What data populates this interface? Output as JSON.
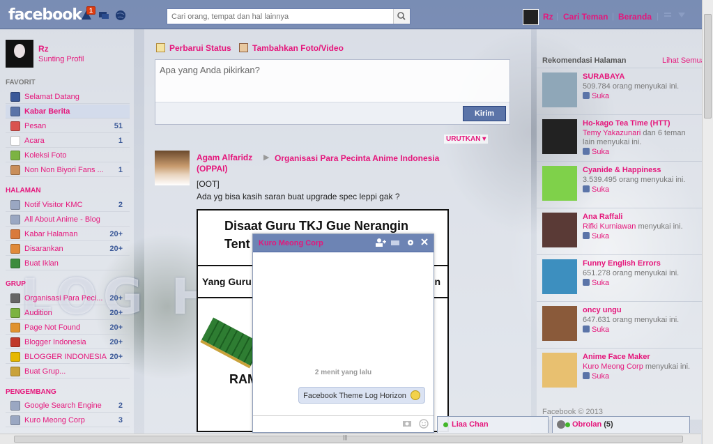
{
  "app": {
    "logo": "facebook",
    "notification_count": "1"
  },
  "search": {
    "placeholder": "Cari orang, tempat dan hal lainnya"
  },
  "topnav": {
    "user": "Rz",
    "find_friends": "Cari Teman",
    "home": "Beranda",
    "sep": "|"
  },
  "profile": {
    "name": "Rz",
    "edit": "Sunting Profil"
  },
  "sidebar": {
    "favorites_head": "FAVORIT",
    "favorites": [
      {
        "label": "Selamat Datang",
        "count": "",
        "color": "#3b5998"
      },
      {
        "label": "Kabar Berita",
        "count": "",
        "color": "#5b74a8"
      },
      {
        "label": "Pesan",
        "count": "51",
        "color": "#d9534f"
      },
      {
        "label": "Acara",
        "count": "1",
        "color": "#ffffff"
      },
      {
        "label": "Koleksi Foto",
        "count": "",
        "color": "#7cb342"
      },
      {
        "label": "Non Non Biyori Fans ...",
        "count": "1",
        "color": "#c98e5a"
      }
    ],
    "pages_head": "HALAMAN",
    "pages": [
      {
        "label": "Notif Visitor KMC",
        "count": "2",
        "color": "#9aa7c2"
      },
      {
        "label": "All About Anime - Blog",
        "count": "",
        "color": "#9aa7c2"
      },
      {
        "label": "Kabar Halaman",
        "count": "20+",
        "color": "#d97a3c"
      },
      {
        "label": "Disarankan",
        "count": "20+",
        "color": "#e08a3a"
      },
      {
        "label": "Buat Iklan",
        "count": "",
        "color": "#3d8c3d"
      }
    ],
    "groups_head": "GRUP",
    "groups": [
      {
        "label": "Organisasi Para Peci...",
        "count": "20+",
        "color": "#666"
      },
      {
        "label": "Audition",
        "count": "20+",
        "color": "#7cb342"
      },
      {
        "label": "Page Not Found",
        "count": "20+",
        "color": "#e0922f"
      },
      {
        "label": "Blogger Indonesia",
        "count": "20+",
        "color": "#c0392b"
      },
      {
        "label": "BLOGGER INDONESIA",
        "count": "20+",
        "color": "#e6b800"
      },
      {
        "label": "Buat Grup...",
        "count": "",
        "color": "#c9a23a"
      }
    ],
    "dev_head": "PENGEMBANG",
    "dev": [
      {
        "label": "Google Search Engine",
        "count": "2",
        "color": "#9aa7c2"
      },
      {
        "label": "Kuro Meong Corp",
        "count": "3",
        "color": "#9aa7c2"
      }
    ]
  },
  "composer": {
    "update_status": "Perbarui Status",
    "add_photo": "Tambahkan Foto/Video",
    "placeholder": "Apa yang Anda pikirkan?",
    "submit": "Kirim"
  },
  "feed": {
    "sort": "URUTKAN",
    "post": {
      "author": "Agam Alfaridz",
      "group_line1": "Organisasi Para Pecinta Anime Indonesia",
      "group_line2": "(OPPAI)",
      "text1": "[OOT]",
      "text2": "Ada yg bisa kasih saran buat upgrade spec leppi gak ?",
      "image_title1": "Disaat Guru TKJ Gue Nerangin",
      "image_title2": "Tent",
      "image_sub": "Yang Guru",
      "image_sub_end": "n",
      "image_label": "RAM"
    }
  },
  "recommend": {
    "head": "Rekomendasi Halaman",
    "see_all": "Lihat Semua",
    "like": "Suka",
    "items": [
      {
        "name": "SURABAYA",
        "meta": "509.784 orang menyukai ini.",
        "color": "#8fa7b8"
      },
      {
        "name": "Ho-kago Tea Time (HTT)",
        "meta_pink": "Temy Yakazunari",
        "meta": " dan 6 teman lain menyukai ini.",
        "color": "#222222"
      },
      {
        "name": "Cyanide & Happiness",
        "meta": "3.539.495 orang menyukai ini.",
        "color": "#7fd14a"
      },
      {
        "name": "Ana Raffali",
        "meta_pink": "Rifki Kurniawan",
        "meta": " menyukai ini.",
        "color": "#5a3a36"
      },
      {
        "name": "Funny English Errors",
        "meta": "651.278 orang menyukai ini.",
        "color": "#3d8fbf"
      },
      {
        "name": "oncy ungu",
        "meta": "647.631 orang menyukai ini.",
        "color": "#8a5a3a"
      },
      {
        "name": "Anime Face Maker",
        "meta_pink": "Kuro Meong Corp",
        "meta": " menyukai ini.",
        "color": "#e8c070"
      }
    ],
    "copyright": "Facebook © 2013"
  },
  "chat": {
    "title": "Kuro Meong Corp",
    "time": "2 menit yang lalu",
    "message": "Facebook Theme Log Horizon"
  },
  "chatbar": {
    "friend": "Liaa Chan",
    "label": "Obrolan",
    "count": "(5)"
  }
}
